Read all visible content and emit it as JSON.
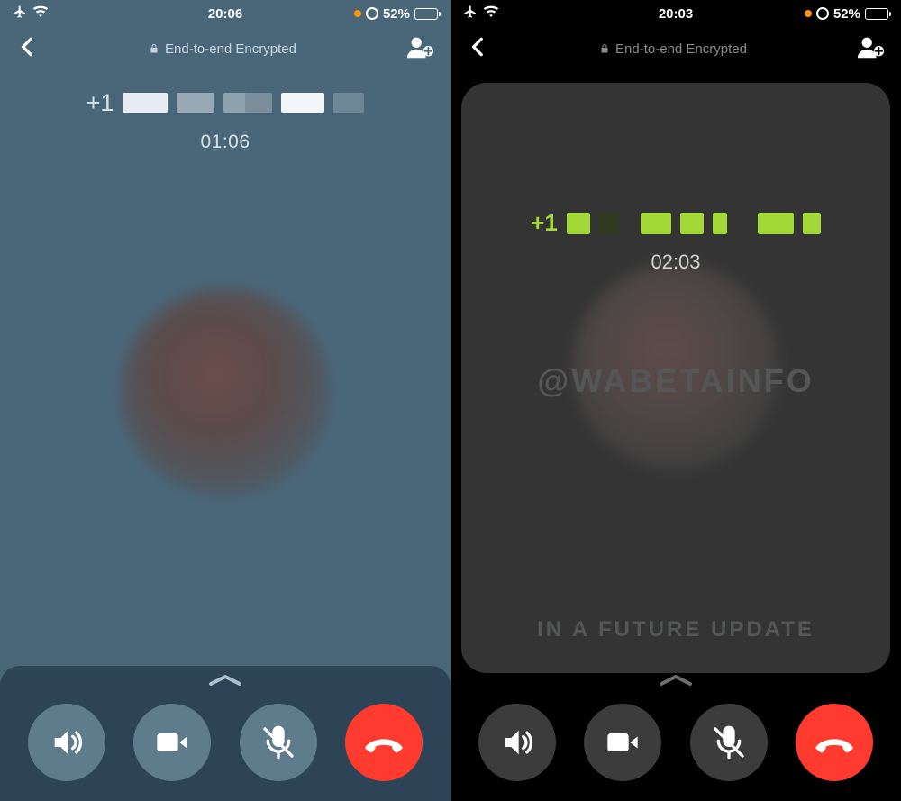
{
  "left": {
    "status": {
      "time": "20:06",
      "battery_pct": "52%"
    },
    "encrypted_label": "End-to-end Encrypted",
    "caller_prefix": "+1",
    "duration": "01:06",
    "buttons": {
      "speaker": "speaker",
      "video": "video",
      "mute": "mute",
      "end": "end-call"
    }
  },
  "right": {
    "status": {
      "time": "20:03",
      "battery_pct": "52%"
    },
    "encrypted_label": "End-to-end Encrypted",
    "caller_prefix": "+1",
    "duration": "02:03",
    "watermark_top": "@WABETAINFO",
    "watermark_bottom": "IN A FUTURE UPDATE",
    "buttons": {
      "speaker": "speaker",
      "video": "video",
      "mute": "mute",
      "end": "end-call"
    }
  }
}
